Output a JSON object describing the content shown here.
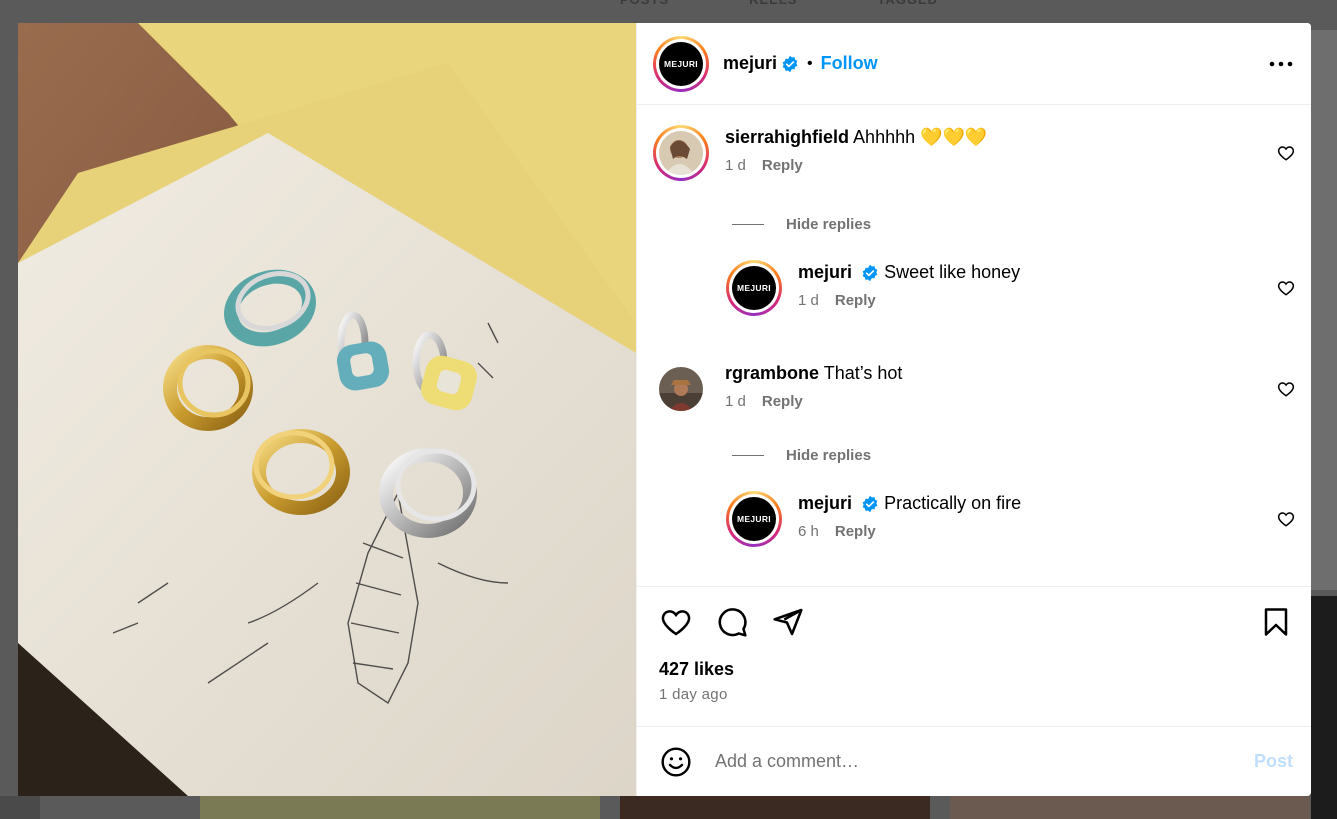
{
  "background_tabs": [
    "POSTS",
    "REELS",
    "TAGGED"
  ],
  "post": {
    "author": {
      "username": "mejuri",
      "avatar_text": "MEJURI",
      "verified": true
    },
    "follow_label": "Follow",
    "separator": "•"
  },
  "comments": [
    {
      "username": "sierrahighfield",
      "text": "Ahhhhh 💛💛💛",
      "time": "1 d",
      "reply_label": "Reply",
      "hide_replies_label": "Hide replies",
      "replies": [
        {
          "username": "mejuri",
          "avatar_text": "MEJURI",
          "verified": true,
          "text": "Sweet like honey",
          "time": "1 d",
          "reply_label": "Reply"
        }
      ]
    },
    {
      "username": "rgrambone",
      "text": "That’s hot",
      "time": "1 d",
      "reply_label": "Reply",
      "hide_replies_label": "Hide replies",
      "replies": [
        {
          "username": "mejuri",
          "avatar_text": "MEJURI",
          "verified": true,
          "text": "Practically on fire",
          "time": "6 h",
          "reply_label": "Reply"
        }
      ]
    }
  ],
  "engagement": {
    "likes": "427 likes",
    "posted": "1 day ago"
  },
  "add_comment": {
    "placeholder": "Add a comment…",
    "post_label": "Post"
  },
  "colors": {
    "accent": "#0095f6",
    "muted_text": "#737373",
    "verified": "#0095f6",
    "post_disabled": "#c0dffd"
  },
  "icons": [
    "verified-icon",
    "more-icon",
    "heart-icon",
    "comment-icon",
    "share-icon",
    "bookmark-icon",
    "emoji-icon"
  ]
}
